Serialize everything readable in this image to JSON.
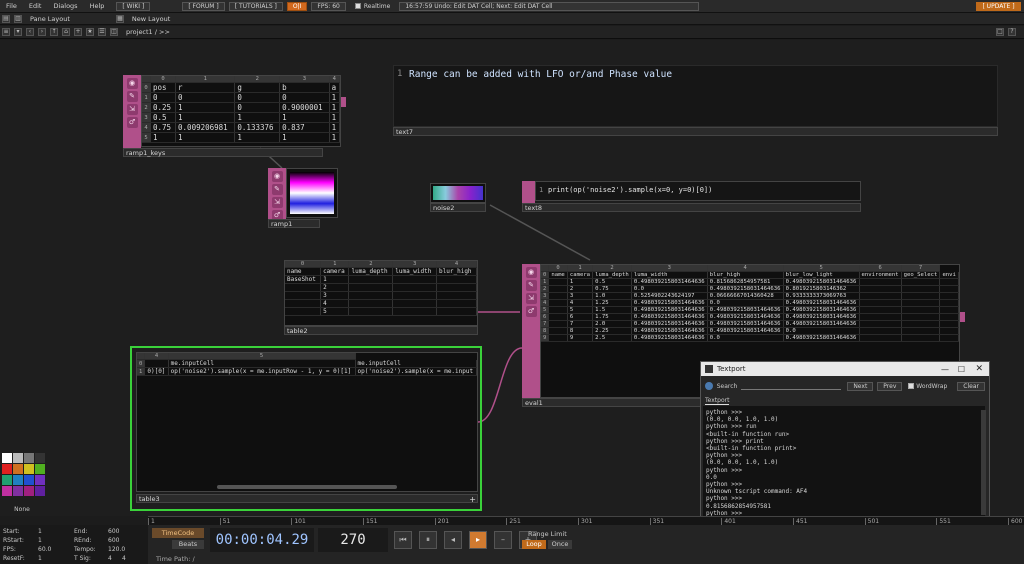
{
  "menubar": {
    "items": [
      "File",
      "Edit",
      "Dialogs",
      "Help"
    ],
    "wiki": "[ WIKI ]",
    "forum": "[ FORUM ]",
    "tutorials": "[ TUTORIALS ]",
    "oi": "O|I",
    "fps": "FPS:  60",
    "realtime": "Realtime",
    "status": "16:57:59 Undo: Edit DAT Cell; Next: Edit DAT Cell",
    "update": "[ UPDATE ]"
  },
  "panebar": {
    "pane_layout": "Pane Layout",
    "new_layout": "New Layout"
  },
  "pathbar": {
    "path": "project1 / >>"
  },
  "nodes": {
    "ramp1_keys": {
      "label": "ramp1_keys",
      "colheaders": [
        "0",
        "1",
        "2",
        "3",
        "4"
      ],
      "rows": [
        [
          "0",
          "pos",
          "r",
          "g",
          "b",
          "a"
        ],
        [
          "1",
          "0",
          "0",
          "0",
          "0",
          "1"
        ],
        [
          "2",
          "0.25",
          "1",
          "0",
          "0.9000001",
          "1"
        ],
        [
          "3",
          "0.5",
          "1",
          "1",
          "1",
          "1"
        ],
        [
          "4",
          "0.75",
          "0.009206981",
          "0.133376",
          "0.837",
          "1"
        ],
        [
          "5",
          "1",
          "1",
          "1",
          "1",
          "1"
        ]
      ]
    },
    "ramp1": {
      "label": "ramp1"
    },
    "noise2": {
      "label": "noise2"
    },
    "text7": {
      "label": "text7",
      "line_no": "1",
      "text": "Range can be added with LFO or/and Phase value"
    },
    "text8": {
      "label": "text8",
      "line_no": "1",
      "text": "print(op('noise2').sample(x=0, y=0)[0])"
    },
    "table2": {
      "label": "table2",
      "colheaders": [
        "0",
        "1",
        "2",
        "3",
        "4"
      ],
      "rows": [
        [
          "name",
          "camera",
          "luma_depth",
          "luma_width",
          "blur_high"
        ],
        [
          "BaseShot",
          "1",
          "",
          "",
          ""
        ],
        [
          "",
          "2",
          "",
          "",
          ""
        ],
        [
          "",
          "3",
          "",
          "",
          ""
        ],
        [
          "",
          "4",
          "",
          "",
          ""
        ],
        [
          "",
          "5",
          "",
          "",
          ""
        ]
      ]
    },
    "eval1": {
      "label": "eval1",
      "colheaders": [
        "0",
        "1",
        "2",
        "3",
        "4",
        "5",
        "6",
        "7"
      ],
      "rows": [
        [
          "0",
          "name",
          "camera",
          "luma_depth",
          "luma_width",
          "blur_high",
          "blur_low_light",
          "environment",
          "geo_Select",
          "envi"
        ],
        [
          "1",
          "",
          "1",
          "0.5",
          "0.4980392158031464636",
          "0.8156862854957581",
          "0.4980392158031464636",
          "",
          "",
          ""
        ],
        [
          "2",
          "",
          "2",
          "0.75",
          "0.0",
          "0.4980392158031464636",
          "0.8019215803146362",
          "",
          "",
          ""
        ],
        [
          "3",
          "",
          "3",
          "1.0",
          "0.5254902243624197",
          "0.06666667014360428",
          "0.9333333373069763",
          "",
          "",
          ""
        ],
        [
          "4",
          "",
          "4",
          "1.25",
          "0.4980392158031464636",
          "0.0",
          "0.4980392158031464636",
          "",
          "",
          ""
        ],
        [
          "5",
          "",
          "5",
          "1.5",
          "0.4980392158031464636",
          "0.4980392158031464636",
          "0.4980392158031464636",
          "",
          "",
          ""
        ],
        [
          "6",
          "",
          "6",
          "1.75",
          "0.4980392158031464636",
          "0.4980392158031464636",
          "0.4980392158031464636",
          "",
          "",
          ""
        ],
        [
          "7",
          "",
          "7",
          "2.0",
          "0.4980392158031464636",
          "0.4980392158031464636",
          "0.4980392158031464636",
          "",
          "",
          ""
        ],
        [
          "8",
          "",
          "8",
          "2.25",
          "0.4980392158031464636",
          "0.4980392158031464636",
          "0.0",
          "",
          "",
          ""
        ],
        [
          "9",
          "",
          "9",
          "2.5",
          "0.4980392158031464636",
          "0.0",
          "0.4980392158031464636",
          "",
          "",
          ""
        ]
      ]
    },
    "table3": {
      "label": "table3",
      "colheaders": [
        "4",
        "5"
      ],
      "rows": [
        [
          "0",
          "",
          "me.inputCell",
          "me.inputCell"
        ],
        [
          "1",
          "0)[0]",
          "op('noise2').sample(x = me.inputRow - 1, y = 0)[1]",
          "op('noise2').sample(x = me.input"
        ]
      ]
    }
  },
  "textport": {
    "title": "Textport",
    "search_label": "Search",
    "next": "Next",
    "prev": "Prev",
    "wordwrap": "WordWrap",
    "clear": "Clear",
    "tab": "Textport",
    "lines": [
      "python >>>",
      "(0.0, 0.0, 1.0, 1.0)",
      "python >>> run",
      "<built-in function run>",
      "python >>> print",
      "<built-in function print>",
      "python >>>",
      "(0.0, 0.0, 1.0, 1.0)",
      "python >>>",
      "0.0",
      "python >>>",
      "Unknown tscript command: AF4",
      "python >>>",
      "0.8156862854957581",
      "python >>>"
    ]
  },
  "palette": {
    "none_label": "None"
  },
  "timeline": {
    "ticks": [
      "1",
      "51",
      "101",
      "151",
      "201",
      "251",
      "301",
      "351",
      "401",
      "451",
      "501",
      "551",
      "600"
    ]
  },
  "bottom": {
    "start_label": "Start:",
    "start": "1",
    "end_label": "End:",
    "end": "600",
    "rstart_label": "RStart:",
    "rstart": "1",
    "rend_label": "REnd:",
    "rend": "600",
    "fps_label": "FPS:",
    "fps": "60.0",
    "tempo_label": "Tempo:",
    "tempo": "120.0",
    "resetf_label": "ResetF:",
    "resetf": "1",
    "tsig_label": "T Sig:",
    "tsig1": "4",
    "tsig2": "4",
    "timecode_btn": "TimeCode",
    "beats_btn": "Beats",
    "timecode": "00:00:04.29",
    "frame": "270",
    "range_limit": "Range Limit",
    "loop": "Loop",
    "once": "Once",
    "time_path": "Time Path: /"
  }
}
